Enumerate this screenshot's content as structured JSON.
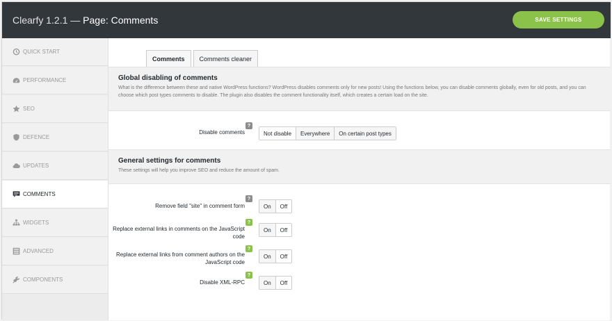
{
  "header": {
    "app": "Clearfy 1.2.1 — ",
    "page": "Page: Comments",
    "save_label": "SAVE SETTINGS"
  },
  "sidebar": {
    "items": [
      {
        "label": "QUICK START",
        "icon": "clock-icon"
      },
      {
        "label": "PERFORMANCE",
        "icon": "dashboard-icon"
      },
      {
        "label": "SEO",
        "icon": "star-icon"
      },
      {
        "label": "DEFENCE",
        "icon": "shield-icon"
      },
      {
        "label": "UPDATES",
        "icon": "cloud-icon"
      },
      {
        "label": "COMMENTS",
        "icon": "comments-icon"
      },
      {
        "label": "WIDGETS",
        "icon": "widgets-icon"
      },
      {
        "label": "ADVANCED",
        "icon": "list-icon"
      },
      {
        "label": "COMPONENTS",
        "icon": "plugin-icon"
      }
    ],
    "active_index": 5
  },
  "tabs": [
    {
      "label": "Comments"
    },
    {
      "label": "Comments cleaner"
    }
  ],
  "global_section": {
    "title": "Global disabling of comments",
    "description": "What is the difference between these and native WordPress functions? WordPress disables comments only for new posts! Using the functions below, you can disable comments globally, even for old posts, and you can choose which post types comments to disable. The plugin also disables the comment functionality itself, which creates a certain load on the site."
  },
  "disable_comments": {
    "label": "Disable comments",
    "help": "?",
    "options": [
      "Not disable",
      "Everywhere",
      "On certain post types"
    ],
    "selected": "Not disable"
  },
  "general_section": {
    "title": "General settings for comments",
    "description": "These settings will help you improve SEO and reduce the amount of spam."
  },
  "settings": [
    {
      "label": "Remove field \"site\" in comment form",
      "help": "?",
      "on": "On",
      "off": "Off"
    },
    {
      "label": "Replace external links in comments on the JavaScript code",
      "help": "?",
      "on": "On",
      "off": "Off"
    },
    {
      "label": "Replace external links from comment authors on the JavaScript code",
      "help": "?",
      "on": "On",
      "off": "Off"
    },
    {
      "label": "Disable XML-RPC",
      "help": "?",
      "on": "On",
      "off": "Off"
    }
  ]
}
